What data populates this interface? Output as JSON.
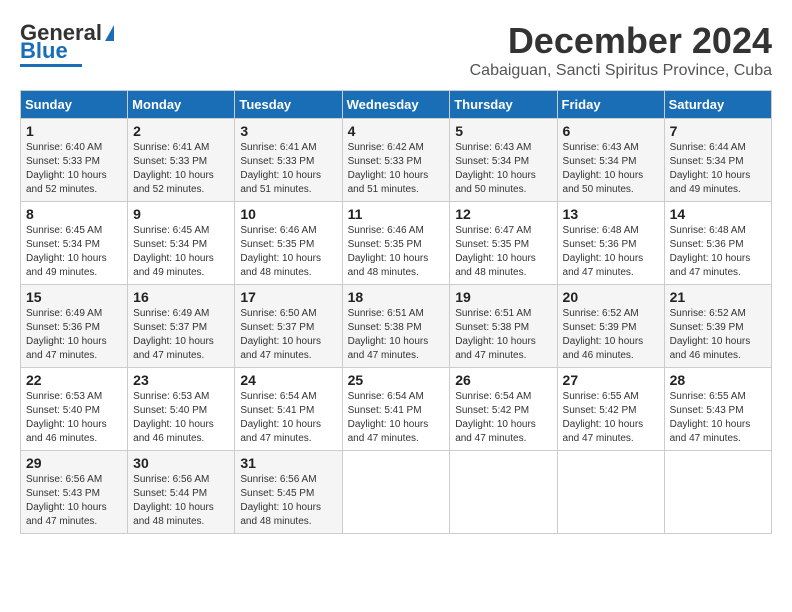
{
  "header": {
    "logo_line1": "General",
    "logo_line2": "Blue",
    "month": "December 2024",
    "location": "Cabaiguan, Sancti Spiritus Province, Cuba"
  },
  "weekdays": [
    "Sunday",
    "Monday",
    "Tuesday",
    "Wednesday",
    "Thursday",
    "Friday",
    "Saturday"
  ],
  "weeks": [
    [
      {
        "day": "1",
        "rise": "6:40 AM",
        "set": "5:33 PM",
        "hours": "10 hours and 52 minutes."
      },
      {
        "day": "2",
        "rise": "6:41 AM",
        "set": "5:33 PM",
        "hours": "10 hours and 52 minutes."
      },
      {
        "day": "3",
        "rise": "6:41 AM",
        "set": "5:33 PM",
        "hours": "10 hours and 51 minutes."
      },
      {
        "day": "4",
        "rise": "6:42 AM",
        "set": "5:33 PM",
        "hours": "10 hours and 51 minutes."
      },
      {
        "day": "5",
        "rise": "6:43 AM",
        "set": "5:34 PM",
        "hours": "10 hours and 50 minutes."
      },
      {
        "day": "6",
        "rise": "6:43 AM",
        "set": "5:34 PM",
        "hours": "10 hours and 50 minutes."
      },
      {
        "day": "7",
        "rise": "6:44 AM",
        "set": "5:34 PM",
        "hours": "10 hours and 49 minutes."
      }
    ],
    [
      {
        "day": "8",
        "rise": "6:45 AM",
        "set": "5:34 PM",
        "hours": "10 hours and 49 minutes."
      },
      {
        "day": "9",
        "rise": "6:45 AM",
        "set": "5:34 PM",
        "hours": "10 hours and 49 minutes."
      },
      {
        "day": "10",
        "rise": "6:46 AM",
        "set": "5:35 PM",
        "hours": "10 hours and 48 minutes."
      },
      {
        "day": "11",
        "rise": "6:46 AM",
        "set": "5:35 PM",
        "hours": "10 hours and 48 minutes."
      },
      {
        "day": "12",
        "rise": "6:47 AM",
        "set": "5:35 PM",
        "hours": "10 hours and 48 minutes."
      },
      {
        "day": "13",
        "rise": "6:48 AM",
        "set": "5:36 PM",
        "hours": "10 hours and 47 minutes."
      },
      {
        "day": "14",
        "rise": "6:48 AM",
        "set": "5:36 PM",
        "hours": "10 hours and 47 minutes."
      }
    ],
    [
      {
        "day": "15",
        "rise": "6:49 AM",
        "set": "5:36 PM",
        "hours": "10 hours and 47 minutes."
      },
      {
        "day": "16",
        "rise": "6:49 AM",
        "set": "5:37 PM",
        "hours": "10 hours and 47 minutes."
      },
      {
        "day": "17",
        "rise": "6:50 AM",
        "set": "5:37 PM",
        "hours": "10 hours and 47 minutes."
      },
      {
        "day": "18",
        "rise": "6:51 AM",
        "set": "5:38 PM",
        "hours": "10 hours and 47 minutes."
      },
      {
        "day": "19",
        "rise": "6:51 AM",
        "set": "5:38 PM",
        "hours": "10 hours and 47 minutes."
      },
      {
        "day": "20",
        "rise": "6:52 AM",
        "set": "5:39 PM",
        "hours": "10 hours and 46 minutes."
      },
      {
        "day": "21",
        "rise": "6:52 AM",
        "set": "5:39 PM",
        "hours": "10 hours and 46 minutes."
      }
    ],
    [
      {
        "day": "22",
        "rise": "6:53 AM",
        "set": "5:40 PM",
        "hours": "10 hours and 46 minutes."
      },
      {
        "day": "23",
        "rise": "6:53 AM",
        "set": "5:40 PM",
        "hours": "10 hours and 46 minutes."
      },
      {
        "day": "24",
        "rise": "6:54 AM",
        "set": "5:41 PM",
        "hours": "10 hours and 47 minutes."
      },
      {
        "day": "25",
        "rise": "6:54 AM",
        "set": "5:41 PM",
        "hours": "10 hours and 47 minutes."
      },
      {
        "day": "26",
        "rise": "6:54 AM",
        "set": "5:42 PM",
        "hours": "10 hours and 47 minutes."
      },
      {
        "day": "27",
        "rise": "6:55 AM",
        "set": "5:42 PM",
        "hours": "10 hours and 47 minutes."
      },
      {
        "day": "28",
        "rise": "6:55 AM",
        "set": "5:43 PM",
        "hours": "10 hours and 47 minutes."
      }
    ],
    [
      {
        "day": "29",
        "rise": "6:56 AM",
        "set": "5:43 PM",
        "hours": "10 hours and 47 minutes."
      },
      {
        "day": "30",
        "rise": "6:56 AM",
        "set": "5:44 PM",
        "hours": "10 hours and 48 minutes."
      },
      {
        "day": "31",
        "rise": "6:56 AM",
        "set": "5:45 PM",
        "hours": "10 hours and 48 minutes."
      },
      null,
      null,
      null,
      null
    ]
  ]
}
